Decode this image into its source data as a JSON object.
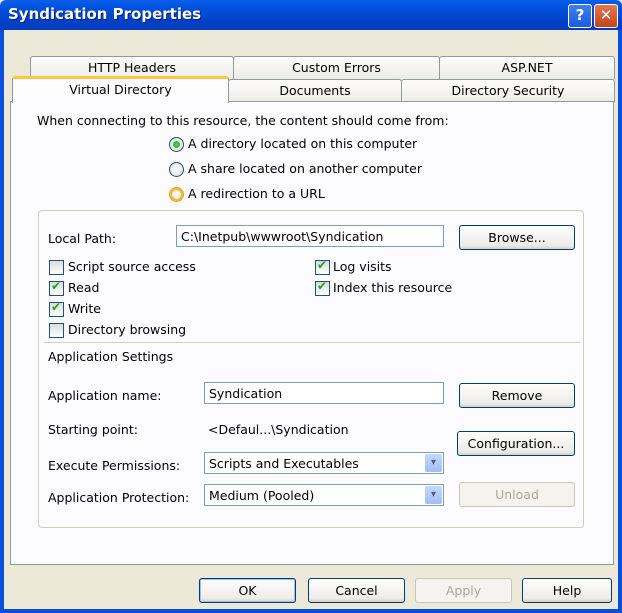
{
  "window": {
    "title": "Syndication Properties",
    "help_glyph": "?",
    "close_glyph": "✕"
  },
  "tabs": {
    "row1": [
      "HTTP Headers",
      "Custom Errors",
      "ASP.NET"
    ],
    "row2": [
      "Virtual Directory",
      "Documents",
      "Directory Security"
    ],
    "selected": "Virtual Directory"
  },
  "content_source": {
    "prompt": "When connecting to this resource, the content should come from:",
    "options": [
      "A directory located on this computer",
      "A share located on another computer",
      "A redirection to a URL"
    ],
    "selected": "A directory located on this computer"
  },
  "local_path": {
    "label": "Local Path:",
    "value": "C:\\Inetpub\\wwwroot\\Syndication",
    "browse": "Browse..."
  },
  "permissions": {
    "script_source": {
      "label": "Script source access",
      "checked": false
    },
    "read": {
      "label": "Read",
      "checked": true
    },
    "write": {
      "label": "Write",
      "checked": true
    },
    "dir_browsing": {
      "label": "Directory browsing",
      "checked": false
    },
    "log_visits": {
      "label": "Log visits",
      "checked": true
    },
    "index": {
      "label": "Index this resource",
      "checked": true
    }
  },
  "app_settings": {
    "heading": "Application Settings",
    "name_label": "Application name:",
    "name_value": "Syndication",
    "remove": "Remove",
    "start_label": "Starting point:",
    "start_value": "<Defaul...\\Syndication",
    "configuration": "Configuration...",
    "exec_label": "Execute Permissions:",
    "exec_value": "Scripts and Executables",
    "protect_label": "Application Protection:",
    "protect_value": "Medium (Pooled)",
    "unload": "Unload"
  },
  "footer": {
    "ok": "OK",
    "cancel": "Cancel",
    "apply": "Apply",
    "help": "Help"
  },
  "icons": {
    "dropdown": "▾"
  }
}
